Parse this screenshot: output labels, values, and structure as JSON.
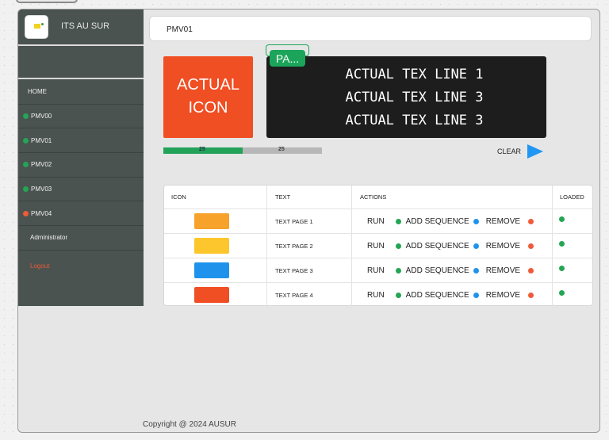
{
  "app": {
    "brand": "ITS AU SUR"
  },
  "header": {
    "title": "PMV01"
  },
  "sidebar": {
    "items": [
      {
        "label": "HOME",
        "status": "none"
      },
      {
        "label": "PMV00",
        "status": "#24a555"
      },
      {
        "label": "PMV01",
        "status": "#24a555"
      },
      {
        "label": "PMV02",
        "status": "#24a555"
      },
      {
        "label": "PMV03",
        "status": "#24a555"
      },
      {
        "label": "PMV04",
        "status": "#ef5a3a"
      }
    ],
    "admin": "Administrator",
    "logout": "Logout"
  },
  "preview": {
    "icon_text": "ACTUAL ICON",
    "icon_line1": "ACTUAL",
    "icon_line2": "ICON",
    "page_badge": "PA...",
    "lines": [
      "ACTUAL TEX LINE 1",
      "ACTUAL TEX LINE 3",
      "ACTUAL TEX LINE 3"
    ]
  },
  "progress": {
    "done_label": "25",
    "remaining_label": "25",
    "fraction": 0.5
  },
  "clear_label": "CLEAR",
  "table": {
    "headers": [
      "ICON",
      "TEXT",
      "ACTIONS",
      "LOADED"
    ],
    "rows": [
      {
        "color": "#f6a22b",
        "text": "TEXT PAGE 1",
        "run": "RUN",
        "add": "ADD SEQUENCE",
        "remove": "REMOVE",
        "loaded": "#24a555"
      },
      {
        "color": "#fcc62c",
        "text": "TEXT PAGE 2",
        "run": "RUN",
        "add": "ADD SEQUENCE",
        "remove": "REMOVE",
        "loaded": "#24a555"
      },
      {
        "color": "#1f93ec",
        "text": "TEXT PAGE 3",
        "run": "RUN",
        "add": "ADD SEQUENCE",
        "remove": "REMOVE",
        "loaded": "#24a555"
      },
      {
        "color": "#f04e23",
        "text": "TEXT PAGE 4",
        "run": "RUN",
        "add": "ADD SEQUENCE",
        "remove": "REMOVE",
        "loaded": "#24a555"
      }
    ],
    "dot_colors": {
      "run": "#24a555",
      "add": "#1f93ec",
      "remove": "#ef5a3a"
    }
  },
  "footer": {
    "copyright": "Copyright @ 2024 AUSUR"
  }
}
